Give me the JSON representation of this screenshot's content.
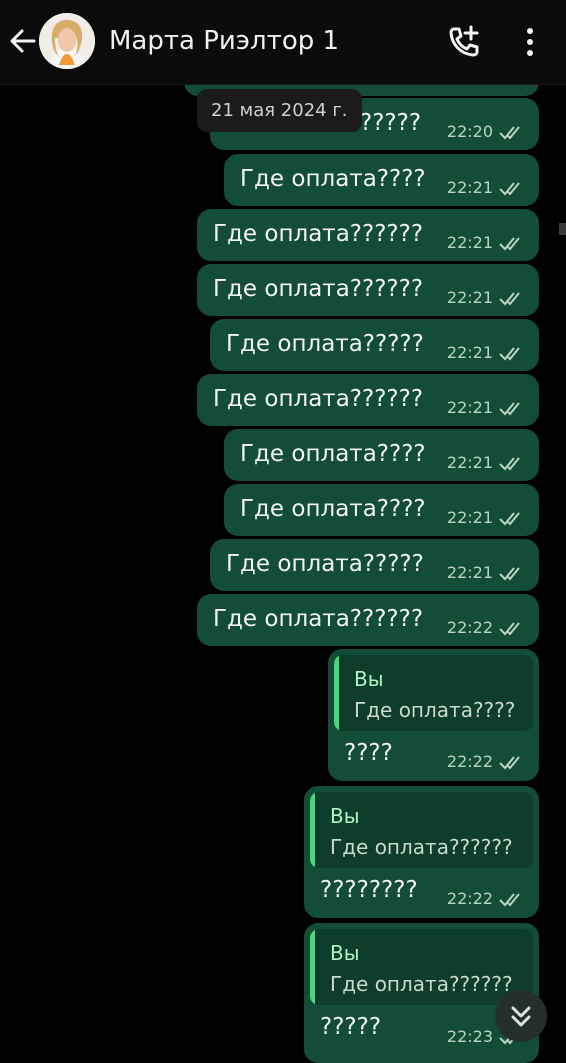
{
  "header": {
    "contact_name": "Марта Риэлтор 1",
    "back_icon": "arrow-left-icon",
    "call_icon": "call-add-icon",
    "menu_icon": "more-vertical-icon"
  },
  "date_label": "21 мая 2024 г.",
  "messages": [
    {
      "text": "?????",
      "time": "22:20"
    },
    {
      "text": "Где оплата????",
      "time": "22:21"
    },
    {
      "text": "Где оплата??????",
      "time": "22:21"
    },
    {
      "text": "Где оплата??????",
      "time": "22:21"
    },
    {
      "text": "Где оплата?????",
      "time": "22:21"
    },
    {
      "text": "Где оплата??????",
      "time": "22:21"
    },
    {
      "text": "Где оплата????",
      "time": "22:21"
    },
    {
      "text": "Где оплата????",
      "time": "22:21"
    },
    {
      "text": "Где оплата?????",
      "time": "22:21"
    },
    {
      "text": "Где оплата??????",
      "time": "22:22"
    }
  ],
  "replies": [
    {
      "quote_author": "Вы",
      "quote_text": "Где оплата????",
      "text": "????",
      "time": "22:22"
    },
    {
      "quote_author": "Вы",
      "quote_text": "Где оплата??????",
      "text": "????????",
      "time": "22:22"
    },
    {
      "quote_author": "Вы",
      "quote_text": "Где оплата??????",
      "text": "?????",
      "time": "22:23"
    }
  ],
  "colors": {
    "bubble": "#134d37",
    "quote_bar": "#49d879",
    "background": "#000000"
  }
}
